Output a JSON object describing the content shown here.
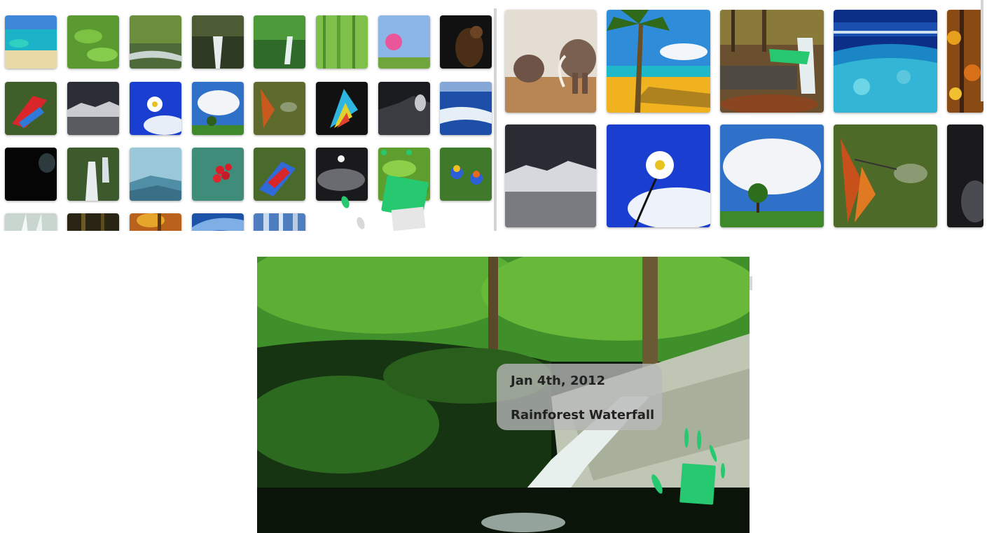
{
  "window": {
    "corner_mark": "..."
  },
  "left_gallery": {
    "thumbnails": [
      {
        "subject": "tropical beach lagoon"
      },
      {
        "subject": "green leaves"
      },
      {
        "subject": "forest stream"
      },
      {
        "subject": "mossy waterfall"
      },
      {
        "subject": "jungle waterfall"
      },
      {
        "subject": "bamboo forest"
      },
      {
        "subject": "pink flower with sky"
      },
      {
        "subject": "eagle"
      },
      {
        "subject": "scarlet macaw"
      },
      {
        "subject": "snowy mountains under dark sky"
      },
      {
        "subject": "daisy against blue sky"
      },
      {
        "subject": "tree under clouds"
      },
      {
        "subject": "hummingbird"
      },
      {
        "subject": "rainbow butterfly"
      },
      {
        "subject": "stormy sky"
      },
      {
        "subject": "ocean wave from above"
      },
      {
        "subject": "tiger in darkness"
      },
      {
        "subject": "cascading waterfall"
      },
      {
        "subject": "misty mountains"
      },
      {
        "subject": "red berries"
      },
      {
        "subject": "macaw flying"
      },
      {
        "subject": "full moon clouds"
      },
      {
        "subject": "green foliage"
      },
      {
        "subject": "lorikeets"
      },
      {
        "subject": "white feathers"
      },
      {
        "subject": "dark forest"
      },
      {
        "subject": "autumn forest"
      },
      {
        "subject": "ocean wave"
      },
      {
        "subject": "blue waterfall"
      }
    ]
  },
  "right_gallery": {
    "thumbnails": [
      {
        "subject": "elephants"
      },
      {
        "subject": "palm beach"
      },
      {
        "subject": "autumn waterfall"
      },
      {
        "subject": "coral reef"
      },
      {
        "subject": "autumn leaves"
      },
      {
        "subject": "snowy mountains under dark sky"
      },
      {
        "subject": "daisy against blue sky"
      },
      {
        "subject": "tree under clouds"
      },
      {
        "subject": "hummingbird"
      },
      {
        "subject": "dark abstract"
      }
    ]
  },
  "viewer": {
    "image_subject": "rainforest waterfall",
    "caption": {
      "date": "Jan 4th, 2012",
      "title": "Rainforest Waterfall"
    }
  },
  "accent_color": "#26c96f"
}
